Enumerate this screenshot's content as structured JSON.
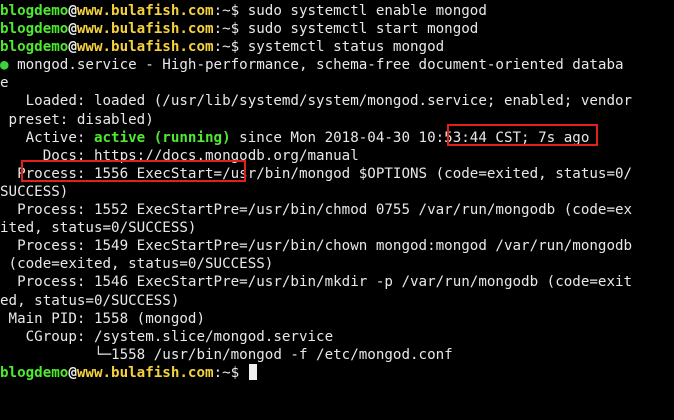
{
  "prompt": {
    "user": "blogdemo",
    "at": "@",
    "host": "www.bulafish.com",
    "sep": ":~$"
  },
  "commands": [
    " sudo systemctl enable mongod",
    " sudo systemctl start mongod",
    " systemctl status mongod"
  ],
  "status": {
    "dot": "●",
    "line1": " mongod.service - High-performance, schema-free document-oriented databa",
    "line1b": "e",
    "loaded_prefix": "   Loaded: loaded (/usr/lib/systemd/system/mongod.",
    "loaded_highlight": "service; enabled",
    "loaded_suffix": "; vendor",
    "loaded_cont": " preset: disabled)",
    "active_prefix": "   Active: ",
    "active_state": "active (running)",
    "active_suffix": " since Mon 2018-04-30 10:53:44 CST; 7s ago",
    "docs": "     Docs: https://docs.mongodb.org/manual",
    "process_lines": [
      "  Process: 1556 ExecStart=/usr/bin/mongod $OPTIONS (code=exited, status=0/",
      "SUCCESS)",
      "  Process: 1552 ExecStartPre=/usr/bin/chmod 0755 /var/run/mongodb (code=ex",
      "ited, status=0/SUCCESS)",
      "  Process: 1549 ExecStartPre=/usr/bin/chown mongod:mongod /var/run/mongodb",
      " (code=exited, status=0/SUCCESS)",
      "  Process: 1546 ExecStartPre=/usr/bin/mkdir -p /var/run/mongodb (code=exit",
      "ed, status=0/SUCCESS)"
    ],
    "main_pid": " Main PID: 1558 (mongod)",
    "cgroup": "   CGroup: /system.slice/mongod.service",
    "cgroup_child": "           └─1558 /usr/bin/mongod -f /etc/mongod.conf"
  },
  "colors": {
    "user": "#4eea2f",
    "host": "#f6d23a",
    "highlight_box": "#e0201c",
    "background": "#000000"
  }
}
